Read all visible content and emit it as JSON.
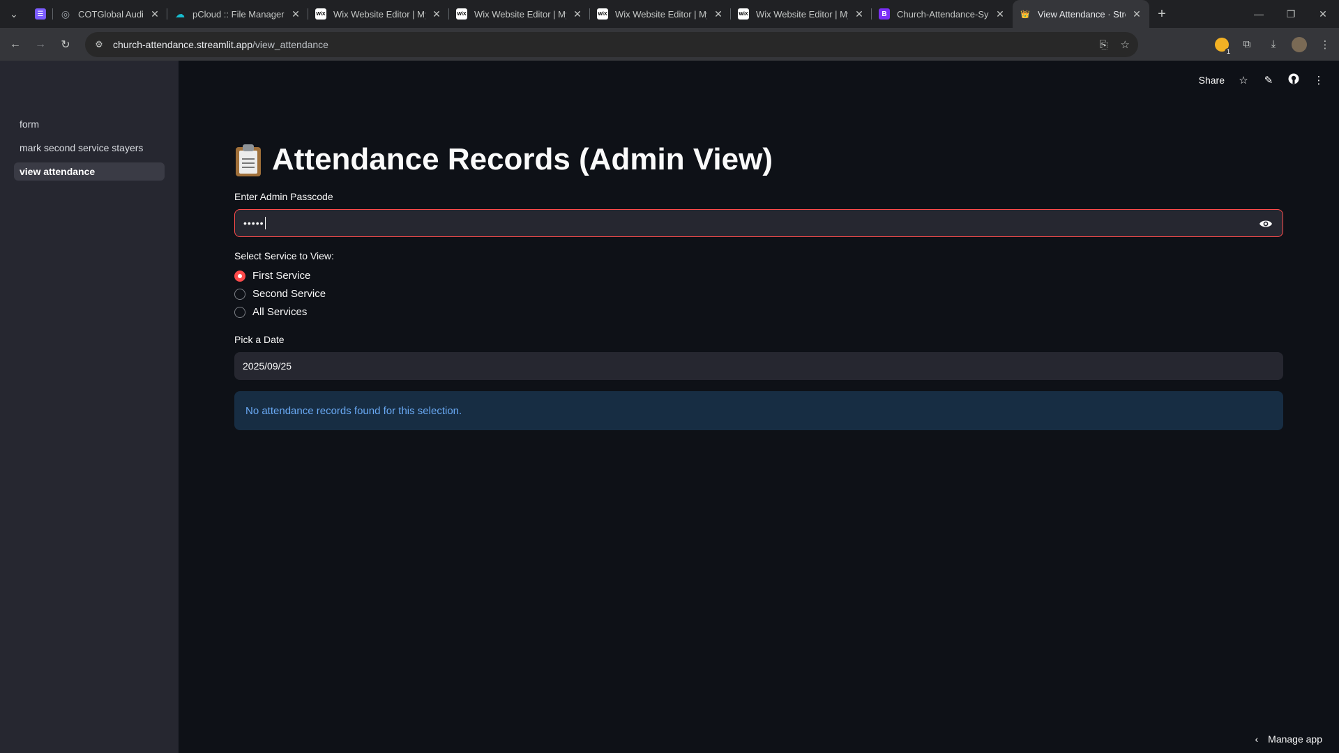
{
  "browser": {
    "tabs": [
      {
        "title": "",
        "favicon": "☰",
        "favicon_color": "#7c5cff"
      },
      {
        "title": "COTGlobal Audio Library",
        "favicon": "◎",
        "favicon_color": "#9aa0a6"
      },
      {
        "title": "pCloud :: File Manager",
        "favicon": "☁",
        "favicon_color": "#17bed0"
      },
      {
        "title": "Wix Website Editor | My",
        "favicon": "WiX",
        "favicon_color": "#ffffff"
      },
      {
        "title": "Wix Website Editor | My",
        "favicon": "WiX",
        "favicon_color": "#ffffff"
      },
      {
        "title": "Wix Website Editor | My",
        "favicon": "WiX",
        "favicon_color": "#ffffff"
      },
      {
        "title": "Wix Website Editor | My",
        "favicon": "WiX",
        "favicon_color": "#ffffff"
      },
      {
        "title": "Church-Attendance-Syst",
        "favicon": "B",
        "favicon_color": "#7b2ff7"
      },
      {
        "title": "View Attendance · Stream",
        "favicon": "👑",
        "favicon_color": "#ff4b4b",
        "active": true
      }
    ],
    "url_host": "church-attendance.streamlit.app",
    "url_path": "/view_attendance",
    "extension_badge": "1"
  },
  "sidebar": {
    "items": [
      {
        "label": "form"
      },
      {
        "label": "mark second service stayers"
      },
      {
        "label": "view attendance",
        "active": true
      }
    ]
  },
  "header": {
    "share_label": "Share"
  },
  "page": {
    "title": "Attendance Records (Admin View)",
    "passcode_label": "Enter Admin Passcode",
    "passcode_value": "•••••",
    "service_label": "Select Service to View:",
    "services": [
      "First Service",
      "Second Service",
      "All Services"
    ],
    "selected_service": "First Service",
    "date_label": "Pick a Date",
    "date_value": "2025/09/25",
    "info_message": "No attendance records found for this selection."
  },
  "footer": {
    "manage_label": "Manage app"
  },
  "colors": {
    "accent": "#ff4b4b",
    "info_bg": "#172d43",
    "info_text": "#6aaaf5"
  }
}
